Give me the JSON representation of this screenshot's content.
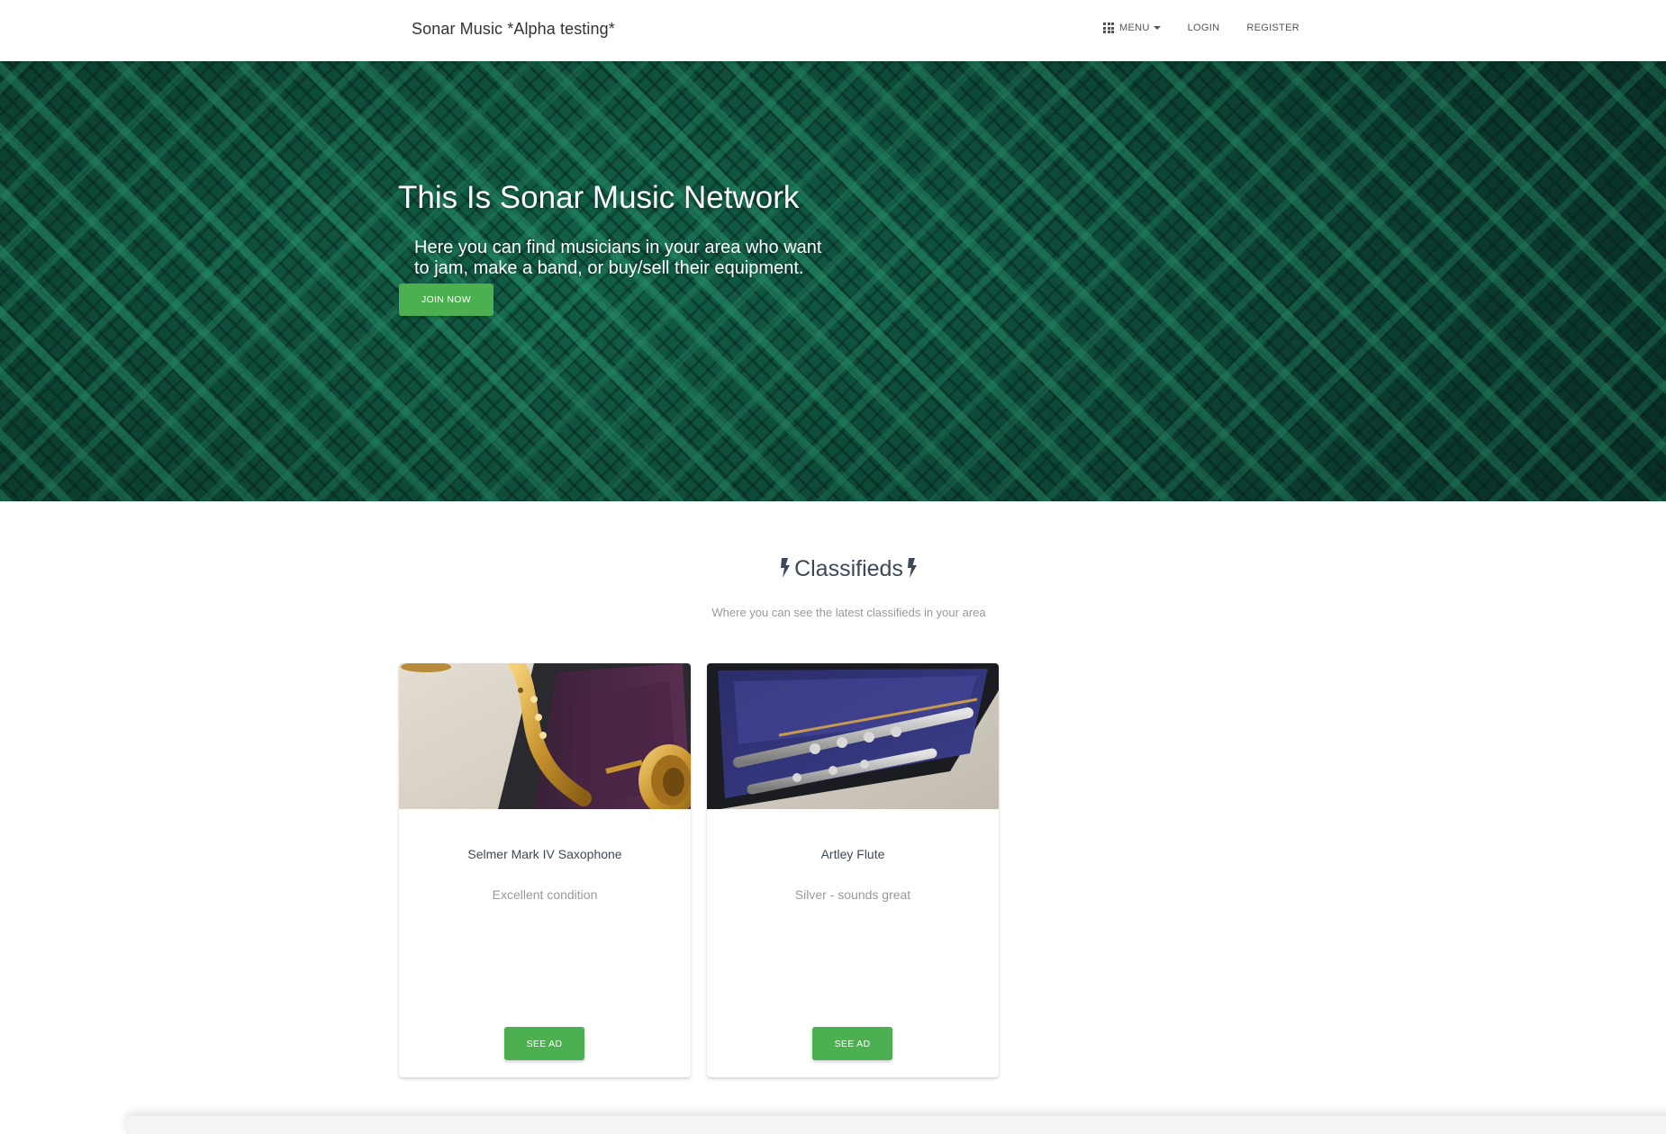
{
  "navbar": {
    "brand": "Sonar Music *Alpha testing*",
    "menu_label": "MENU",
    "login_label": "LOGIN",
    "register_label": "REGISTER"
  },
  "hero": {
    "title": "This Is Sonar Music Network",
    "subtitle": "Here you can find musicians in your area who want to jam, make a band, or buy/sell their equipment.",
    "join_label": "JOIN NOW"
  },
  "classifieds": {
    "title": "Classifieds",
    "subtitle": "Where you can see the latest classifieds in your area",
    "items": [
      {
        "title": "Selmer Mark IV Saxophone",
        "description": "Excellent condition",
        "button_label": "SEE AD"
      },
      {
        "title": "Artley Flute",
        "description": "Silver - sounds great",
        "button_label": "SEE AD"
      }
    ]
  },
  "colors": {
    "accent_green": "#4caf50",
    "hero_green": "#12523f"
  }
}
